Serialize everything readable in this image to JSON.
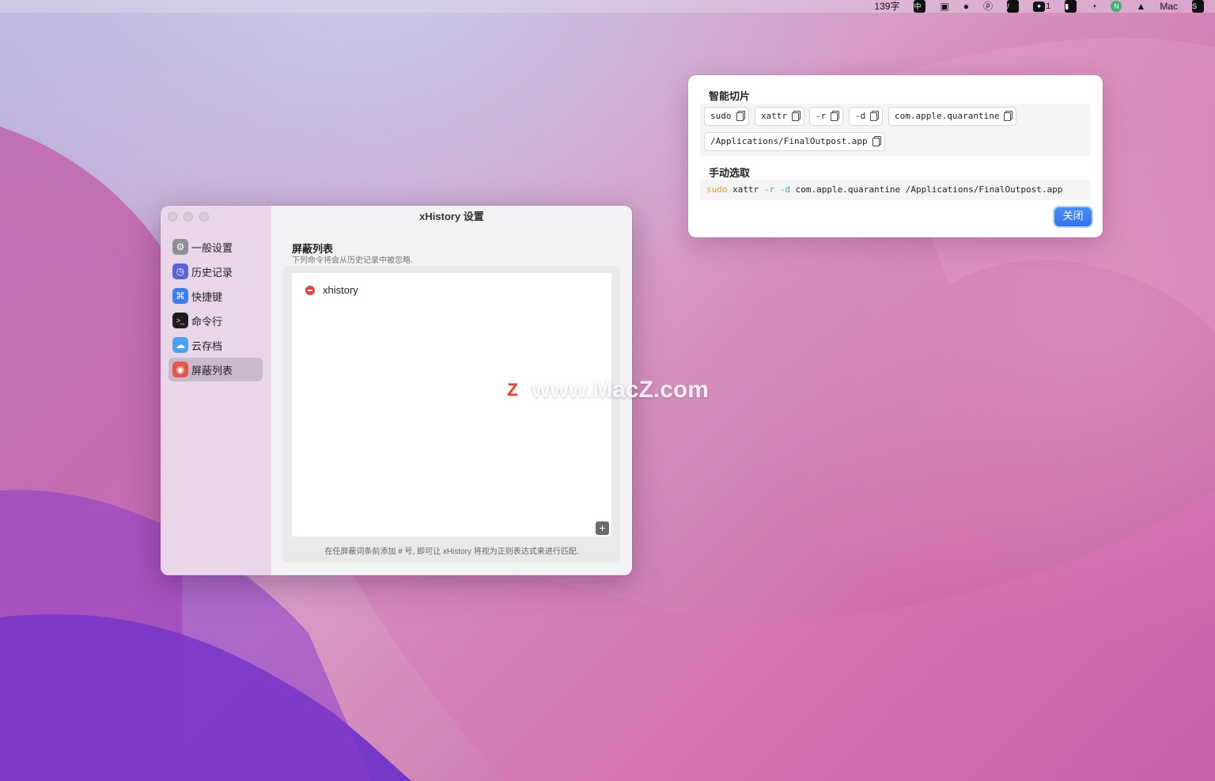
{
  "menubar": {
    "char_count": "139字",
    "input_method": "中",
    "user": "Mac",
    "icons": [
      "keyboard-icon",
      "video-icon",
      "app-icon",
      "p-icon",
      "slash-icon",
      "badge-icon",
      "lock-icon",
      "wechat-icon",
      "n-icon",
      "notification-icon",
      "s-icon"
    ],
    "badge_count": "1"
  },
  "window": {
    "title": "xHistory 设置",
    "sidebar": [
      {
        "label": "一般设置",
        "icon": "gear-icon",
        "color": "#8e8e93"
      },
      {
        "label": "历史记录",
        "icon": "clock-icon",
        "color": "#5a63d8"
      },
      {
        "label": "快捷键",
        "icon": "command-icon",
        "color": "#3a7ff0"
      },
      {
        "label": "命令行",
        "icon": "terminal-icon",
        "color": "#1c1c1e"
      },
      {
        "label": "云存档",
        "icon": "cloud-icon",
        "color": "#4aa3f0"
      },
      {
        "label": "屏蔽列表",
        "icon": "eye-slash-icon",
        "color": "#e2574c",
        "active": true
      }
    ],
    "section_title": "屏蔽列表",
    "section_subtitle": "下列命令将会从历史记录中被忽略.",
    "blocked": [
      "xhistory"
    ],
    "add_label": "+",
    "hint": "在任屏蔽词条前添加 # 号, 即可让 xHistory 将视为正则表达式来进行匹配."
  },
  "popup": {
    "smart_label": "智能切片",
    "chips": [
      "sudo",
      "xattr",
      "-r",
      "-d",
      "com.apple.quarantine",
      "/Applications/FinalOutpost.app"
    ],
    "manual_label": "手动选取",
    "manual": {
      "sudo": "sudo",
      "xattr": "xattr",
      "r": "-r",
      "d": "-d",
      "rest": "com.apple.quarantine /Applications/FinalOutpost.app"
    },
    "close_label": "关闭",
    "accent": "#2f74ea"
  },
  "watermark": {
    "logo": "Z",
    "text": "www.MacZ.com"
  }
}
